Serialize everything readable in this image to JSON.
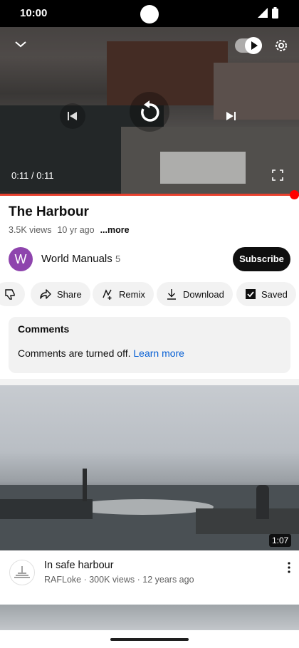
{
  "status_bar": {
    "time": "10:00"
  },
  "player": {
    "time_current": "0:11",
    "time_separator": " / ",
    "time_total": "0:11",
    "progress_fraction": 1.0
  },
  "video": {
    "title": "The Harbour",
    "views": "3.5K views",
    "age": "10 yr ago",
    "more_label": "...more"
  },
  "channel": {
    "avatar_letter": "W",
    "name": "World Manuals",
    "subscriber_count": "5",
    "subscribe_label": "Subscribe"
  },
  "actions": {
    "share_label": "Share",
    "remix_label": "Remix",
    "download_label": "Download",
    "saved_label": "Saved"
  },
  "comments": {
    "title": "Comments",
    "message": "Comments are turned off.",
    "link_label": "Learn more"
  },
  "recommendation": {
    "duration": "1:07",
    "title": "In safe harbour",
    "meta": "RAFLoke · 300K views · 12 years ago"
  },
  "colors": {
    "progress": "#ff0000",
    "link": "#065fd4",
    "channel_avatar": "#8e44ad",
    "subscribe_bg": "#0f0f0f"
  }
}
